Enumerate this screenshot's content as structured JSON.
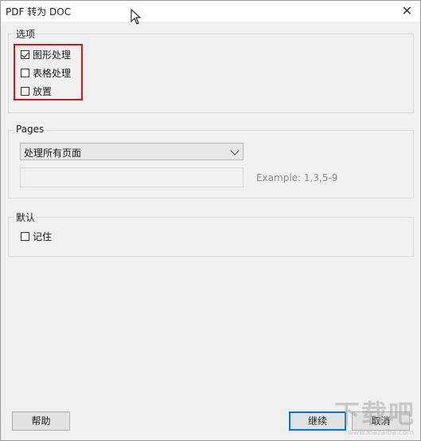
{
  "window": {
    "title": "PDF 转为 DOC",
    "close_glyph": "✕"
  },
  "options_group": {
    "legend": "选项",
    "items": [
      {
        "label": "图形处理",
        "checked": true
      },
      {
        "label": "表格处理",
        "checked": false
      },
      {
        "label": "放置",
        "checked": false
      }
    ]
  },
  "pages_group": {
    "legend": "Pages",
    "select_value": "处理所有页面",
    "range_value": "",
    "range_hint": "Example: 1,3,5-9"
  },
  "default_group": {
    "legend": "默认",
    "remember_label": "记住",
    "remember_checked": false
  },
  "buttons": {
    "help": "帮助",
    "continue": "继续",
    "cancel": "取消"
  },
  "watermark": {
    "text": "下载吧",
    "subtext": "www.xiazaiba.com"
  },
  "colors": {
    "highlight": "#d4141c",
    "default_button_border": "#0078d7"
  }
}
